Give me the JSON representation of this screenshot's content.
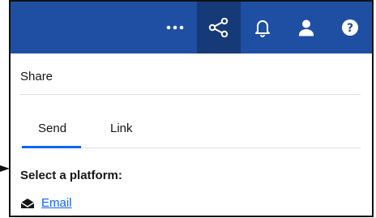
{
  "topbar": {
    "more_icon": "overflow-menu-icon",
    "share_icon": "share-icon",
    "notifications_icon": "bell-icon",
    "user_icon": "user-icon",
    "help_icon": "help-icon",
    "background": "#1f4fa3",
    "active_background": "#163a78"
  },
  "panel": {
    "title": "Share",
    "tabs": [
      {
        "label": "Send",
        "selected": true
      },
      {
        "label": "Link",
        "selected": false
      }
    ],
    "section_label": "Select a platform:",
    "platforms": [
      {
        "label": "Email",
        "icon": "email-icon"
      }
    ]
  },
  "accent": "#0f62fe"
}
